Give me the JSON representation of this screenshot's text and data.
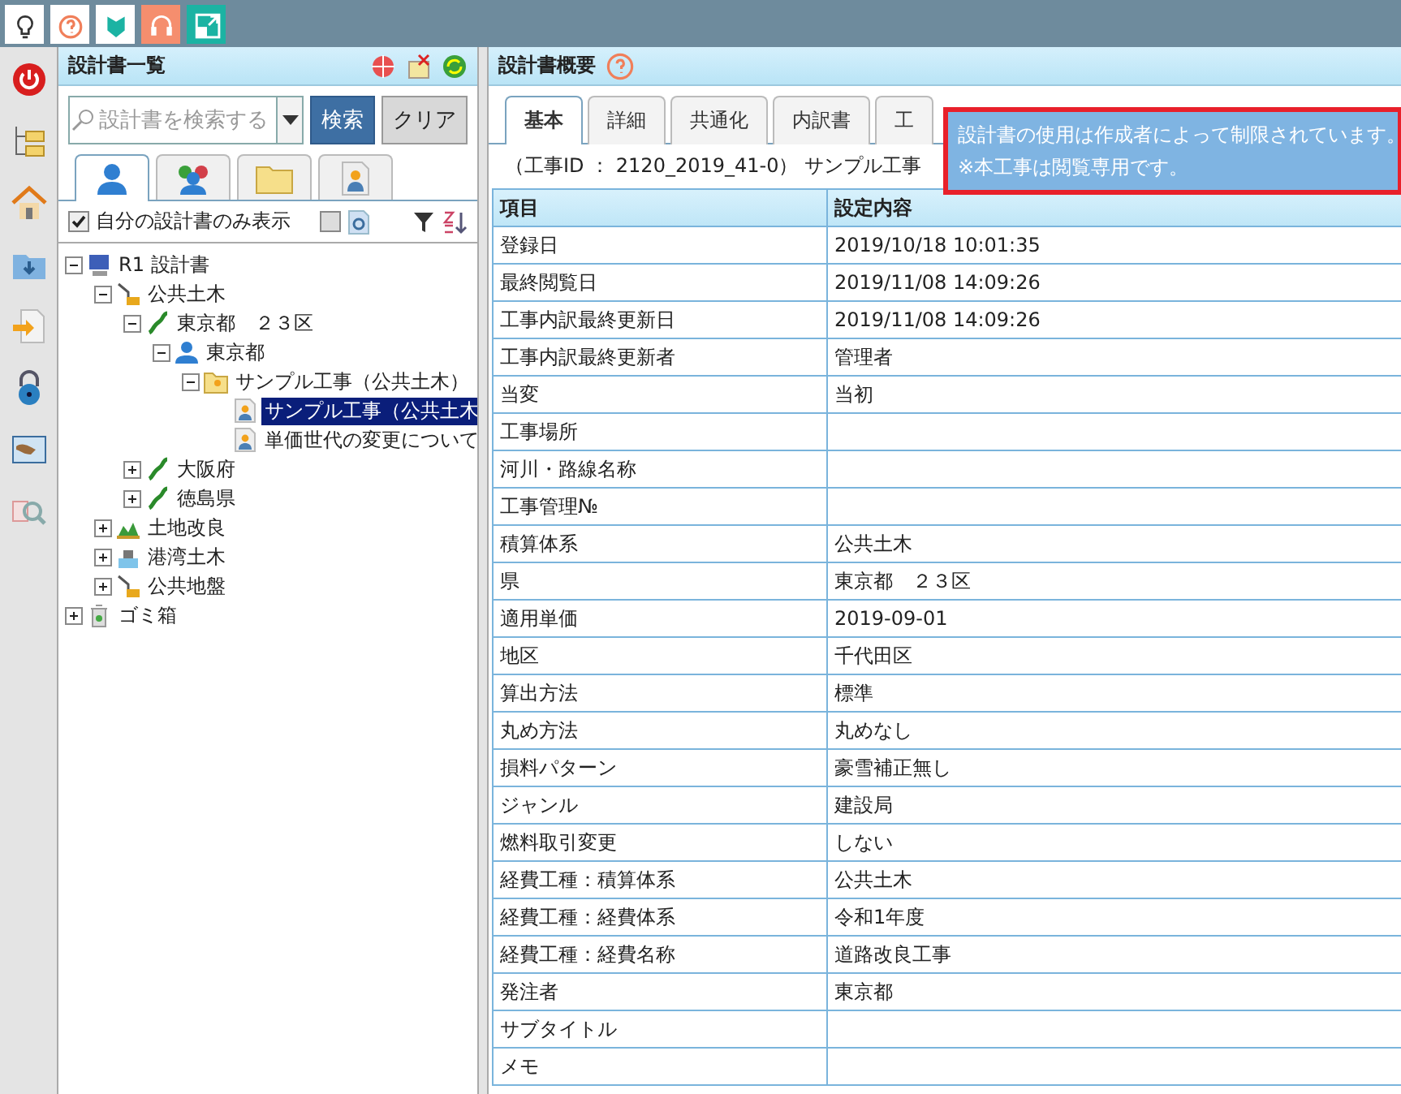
{
  "left_panel": {
    "title": "設計書一覧",
    "search": {
      "placeholder": "設計書を検索する"
    },
    "search_button": "検索",
    "clear_button": "クリア",
    "view_tabs": [
      {
        "kind": "user",
        "selected": true
      },
      {
        "kind": "group",
        "selected": false
      },
      {
        "kind": "folder",
        "selected": false
      },
      {
        "kind": "person-doc",
        "selected": false
      }
    ],
    "own_only": {
      "label": "自分の設計書のみ表示",
      "checked": true
    },
    "preview": {
      "checked": false
    },
    "tree": [
      {
        "label": "R1 設計書",
        "kind": "computer",
        "expanded": true,
        "selected": false,
        "children": [
          {
            "label": "公共土木",
            "kind": "excavator",
            "expanded": true,
            "selected": false,
            "children": [
              {
                "label": "東京都　２３区",
                "kind": "map",
                "expanded": true,
                "selected": false,
                "children": [
                  {
                    "label": "東京都",
                    "kind": "user",
                    "expanded": true,
                    "selected": false,
                    "children": [
                      {
                        "label": "サンプル工事（公共土木）",
                        "kind": "folder",
                        "expanded": true,
                        "selected": false,
                        "children": [
                          {
                            "label": "サンプル工事（公共土木",
                            "kind": "doc",
                            "selected": true
                          },
                          {
                            "label": "単価世代の変更について",
                            "kind": "doc",
                            "selected": false
                          }
                        ]
                      }
                    ]
                  }
                ]
              },
              {
                "label": "大阪府",
                "kind": "map",
                "expanded": false,
                "selected": false
              },
              {
                "label": "徳島県",
                "kind": "map",
                "expanded": false,
                "selected": false
              }
            ]
          },
          {
            "label": "土地改良",
            "kind": "field",
            "expanded": false,
            "selected": false
          },
          {
            "label": "港湾土木",
            "kind": "ship",
            "expanded": false,
            "selected": false
          },
          {
            "label": "公共地盤",
            "kind": "excavator",
            "expanded": false,
            "selected": false
          }
        ]
      },
      {
        "label": "ゴミ箱",
        "kind": "trash",
        "expanded": false,
        "selected": false
      }
    ]
  },
  "right_panel": {
    "title": "設計書概要",
    "tabs": [
      {
        "label": "基本",
        "selected": true
      },
      {
        "label": "詳細",
        "selected": false
      },
      {
        "label": "共通化",
        "selected": false
      },
      {
        "label": "内訳書",
        "selected": false
      },
      {
        "label": "工",
        "selected": false
      }
    ],
    "info": "（工事ID ： 2120_2019_41-0） サンプル工事",
    "tooltip": [
      "設計書の使用は作成者によって制限されています。",
      "※本工事は閲覧専用です。"
    ],
    "table": {
      "columns": [
        "項目",
        "設定内容"
      ],
      "rows": [
        {
          "item": "登録日",
          "value": "2019/10/18 10:01:35"
        },
        {
          "item": "最終閲覧日",
          "value": "2019/11/08 14:09:26"
        },
        {
          "item": "工事内訳最終更新日",
          "value": "2019/11/08 14:09:26"
        },
        {
          "item": "工事内訳最終更新者",
          "value": "管理者"
        },
        {
          "item": "当変",
          "value": "当初"
        },
        {
          "item": "工事場所"
        },
        {
          "item": "河川・路線名称"
        },
        {
          "item": "工事管理№"
        },
        {
          "item": "積算体系",
          "value": "公共土木"
        },
        {
          "item": "県",
          "value": "東京都　２３区"
        },
        {
          "item": "適用単価",
          "value": "2019-09-01"
        },
        {
          "item": "地区",
          "value": "千代田区"
        },
        {
          "item": "算出方法",
          "value": "標準"
        },
        {
          "item": "丸め方法",
          "value": "丸めなし"
        },
        {
          "item": "損料パターン",
          "value": "豪雪補正無し"
        },
        {
          "item": "ジャンル",
          "value": "建設局"
        },
        {
          "item": "燃料取引変更",
          "value": "しない"
        },
        {
          "item": "経費工種：積算体系",
          "value": "公共土木"
        },
        {
          "item": "経費工種：経費体系",
          "value": "令和1年度"
        },
        {
          "item": "経費工種：経費名称",
          "value": "道路改良工事"
        },
        {
          "item": "発注者",
          "value": "東京都"
        },
        {
          "item": "サブタイトル"
        },
        {
          "item": "メモ"
        }
      ]
    }
  }
}
